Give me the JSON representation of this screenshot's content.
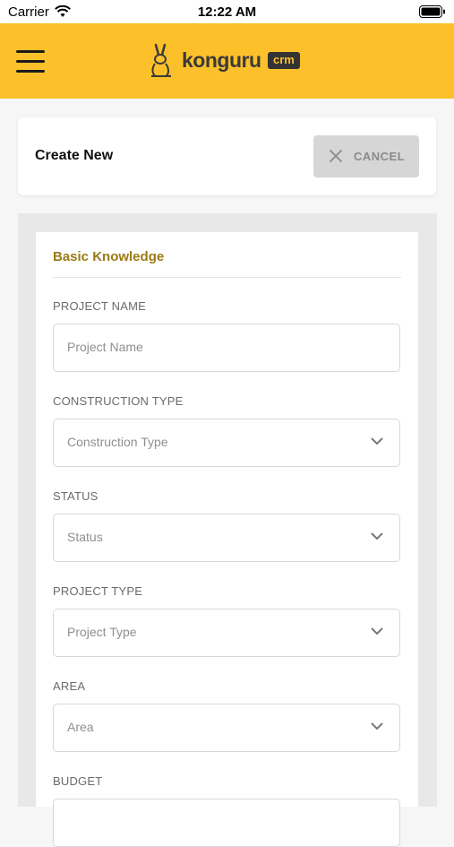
{
  "status_bar": {
    "carrier": "Carrier",
    "time": "12:22 AM"
  },
  "header": {
    "logo_word": "konguru",
    "logo_badge": "crm",
    "accent": "#fcc12a"
  },
  "top_card": {
    "title": "Create New",
    "cancel_label": "CANCEL"
  },
  "form": {
    "section_title": "Basic Knowledge",
    "fields": [
      {
        "label": "PROJECT NAME",
        "placeholder": "Project Name",
        "type": "text"
      },
      {
        "label": "CONSTRUCTION TYPE",
        "placeholder": "Construction Type",
        "type": "select"
      },
      {
        "label": "STATUS",
        "placeholder": "Status",
        "type": "select"
      },
      {
        "label": "PROJECT TYPE",
        "placeholder": "Project Type",
        "type": "select"
      },
      {
        "label": "AREA",
        "placeholder": "Area",
        "type": "select"
      },
      {
        "label": "BUDGET",
        "placeholder": "",
        "type": "text"
      }
    ]
  }
}
